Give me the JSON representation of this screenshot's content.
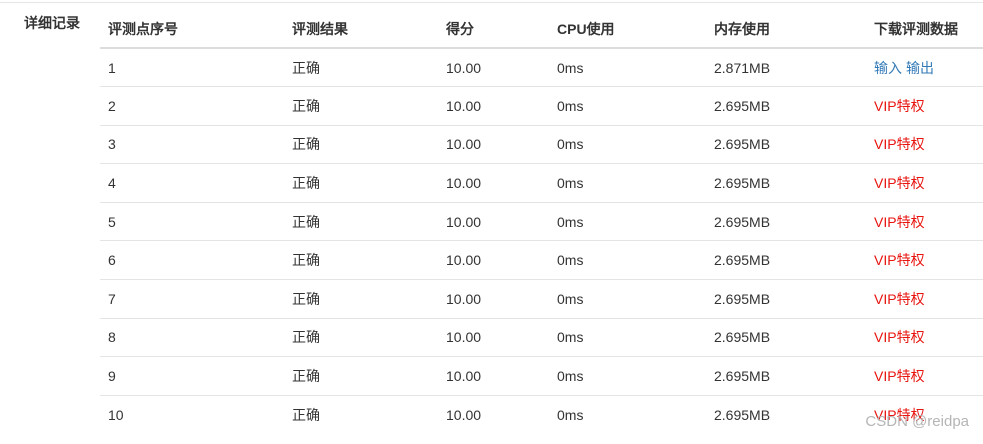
{
  "section_label": "详细记录",
  "columns": [
    "评测点序号",
    "评测结果",
    "得分",
    "CPU使用",
    "内存使用",
    "下载评测数据"
  ],
  "rows": [
    {
      "index": "1",
      "result": "正确",
      "score": "10.00",
      "cpu": "0ms",
      "memory": "2.871MB",
      "download": {
        "type": "links",
        "input_label": "输入",
        "output_label": "输出"
      }
    },
    {
      "index": "2",
      "result": "正确",
      "score": "10.00",
      "cpu": "0ms",
      "memory": "2.695MB",
      "download": {
        "type": "vip",
        "label": "VIP特权"
      }
    },
    {
      "index": "3",
      "result": "正确",
      "score": "10.00",
      "cpu": "0ms",
      "memory": "2.695MB",
      "download": {
        "type": "vip",
        "label": "VIP特权"
      }
    },
    {
      "index": "4",
      "result": "正确",
      "score": "10.00",
      "cpu": "0ms",
      "memory": "2.695MB",
      "download": {
        "type": "vip",
        "label": "VIP特权"
      }
    },
    {
      "index": "5",
      "result": "正确",
      "score": "10.00",
      "cpu": "0ms",
      "memory": "2.695MB",
      "download": {
        "type": "vip",
        "label": "VIP特权"
      }
    },
    {
      "index": "6",
      "result": "正确",
      "score": "10.00",
      "cpu": "0ms",
      "memory": "2.695MB",
      "download": {
        "type": "vip",
        "label": "VIP特权"
      }
    },
    {
      "index": "7",
      "result": "正确",
      "score": "10.00",
      "cpu": "0ms",
      "memory": "2.695MB",
      "download": {
        "type": "vip",
        "label": "VIP特权"
      }
    },
    {
      "index": "8",
      "result": "正确",
      "score": "10.00",
      "cpu": "0ms",
      "memory": "2.695MB",
      "download": {
        "type": "vip",
        "label": "VIP特权"
      }
    },
    {
      "index": "9",
      "result": "正确",
      "score": "10.00",
      "cpu": "0ms",
      "memory": "2.695MB",
      "download": {
        "type": "vip",
        "label": "VIP特权"
      }
    },
    {
      "index": "10",
      "result": "正确",
      "score": "10.00",
      "cpu": "0ms",
      "memory": "2.695MB",
      "download": {
        "type": "vip",
        "label": "VIP特权"
      }
    }
  ],
  "watermark": "CSDN @reidpa",
  "colors": {
    "link": "#337ab7",
    "vip": "#e8140f",
    "text": "#333333",
    "watermark": "#b5b5b5"
  }
}
